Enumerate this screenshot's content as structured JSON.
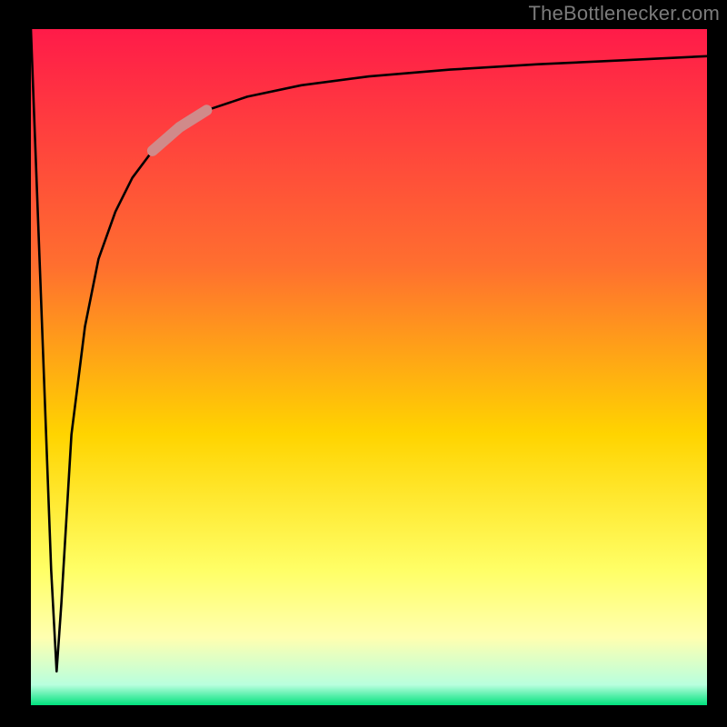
{
  "watermark": "TheBottlenecker.com",
  "colors": {
    "frame": "#000000",
    "curve": "#000000",
    "highlight": "#d08a8a",
    "gradient_top": "#ff1b49",
    "gradient_mid_top": "#ff6f2f",
    "gradient_mid": "#ffd400",
    "gradient_soft": "#ffffb0",
    "gradient_bottom": "#00e17d"
  },
  "chart_data": {
    "type": "line",
    "title": "",
    "xlabel": "",
    "ylabel": "",
    "xlim": [
      0,
      100
    ],
    "ylim": [
      0,
      100
    ],
    "grid": false,
    "legend": false,
    "note": "Values are read from pixel positions; x and y are normalized 0–100 within the plot frame, y=0 at bottom.",
    "series": [
      {
        "name": "bottleneck-curve",
        "x": [
          0,
          1.5,
          3,
          3.8,
          4.5,
          6,
          8,
          10,
          12.5,
          15,
          18,
          22,
          26,
          32,
          40,
          50,
          62,
          75,
          88,
          100
        ],
        "y": [
          100,
          60,
          20,
          5,
          15,
          40,
          56,
          66,
          73,
          78,
          82,
          85.5,
          88,
          90,
          91.7,
          93,
          94,
          94.8,
          95.4,
          96
        ]
      }
    ],
    "highlight_segment": {
      "series": "bottleneck-curve",
      "x_range": [
        18,
        27
      ],
      "y_range": [
        80,
        87
      ],
      "color": "#d08a8a"
    },
    "background_gradient": {
      "direction": "vertical",
      "stops": [
        {
          "offset": 0.0,
          "color": "#ff1b49"
        },
        {
          "offset": 0.35,
          "color": "#ff6f2f"
        },
        {
          "offset": 0.6,
          "color": "#ffd400"
        },
        {
          "offset": 0.8,
          "color": "#ffff66"
        },
        {
          "offset": 0.9,
          "color": "#ffffd0"
        },
        {
          "offset": 0.97,
          "color": "#b8ffde"
        },
        {
          "offset": 1.0,
          "color": "#00e17d"
        }
      ]
    }
  }
}
